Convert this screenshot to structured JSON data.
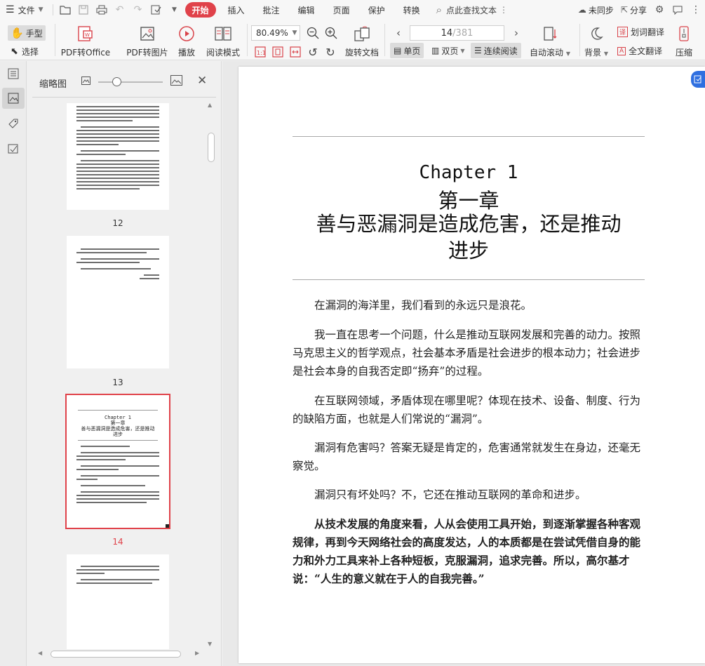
{
  "menubar": {
    "file_label": "文件",
    "tabs": [
      "开始",
      "插入",
      "批注",
      "编辑",
      "页面",
      "保护",
      "转换"
    ],
    "active_tab": "开始",
    "search_label": "点此查找文本",
    "sync_label": "未同步",
    "share_label": "分享"
  },
  "toolbar": {
    "hand_label": "手型",
    "select_label": "选择",
    "pdf_to_office": "PDF转Office",
    "pdf_to_image": "PDF转图片",
    "play": "播放",
    "read_mode": "阅读模式",
    "zoom": "80.49%",
    "rotate_doc": "旋转文档",
    "page_current": "14",
    "page_total": "/381",
    "single_page": "单页",
    "double_page": "双页",
    "continuous": "连续阅读",
    "auto_scroll": "自动滚动",
    "background": "背景",
    "word_translate": "划词翻译",
    "full_translate": "全文翻译",
    "compress": "压缩"
  },
  "thumbnails": {
    "title": "缩略图",
    "pages": [
      {
        "number": "12"
      },
      {
        "number": "13"
      },
      {
        "number": "14",
        "current": true
      }
    ],
    "thumb14": {
      "en": "Chapter 1",
      "cn": "第一章",
      "title_1": "善与恶漏洞是造成危害，还是推动",
      "title_2": "进步"
    }
  },
  "document": {
    "chapter_en": "Chapter 1",
    "chapter_cn": "第一章",
    "title_line1": "善与恶漏洞是造成危害，还是推动",
    "title_line2": "进步",
    "paragraphs": [
      "在漏洞的海洋里，我们看到的永远只是浪花。",
      "我一直在思考一个问题，什么是推动互联网发展和完善的动力。按照马克思主义的哲学观点，社会基本矛盾是社会进步的根本动力；社会进步是社会本身的自我否定即“扬弃”的过程。",
      "在互联网领域，矛盾体现在哪里呢？体现在技术、设备、制度、行为的缺陷方面，也就是人们常说的“漏洞”。",
      "漏洞有危害吗？答案无疑是肯定的，危害通常就发生在身边，还毫无察觉。",
      "漏洞只有坏处吗？不，它还在推动互联网的革命和进步。"
    ],
    "bold_paragraph": "从技术发展的角度来看，人从会使用工具开始，到逐渐掌握各种客观规律，再到今天网络社会的高度发达，人的本质都是在尝试凭借自身的能力和外力工具来补上各种短板，克服漏洞，追求完善。所以，高尔基才说：“人生的意义就在于人的自我完善。”"
  },
  "colors": {
    "accent": "#e0424a",
    "badge": "#2f6fe0"
  }
}
